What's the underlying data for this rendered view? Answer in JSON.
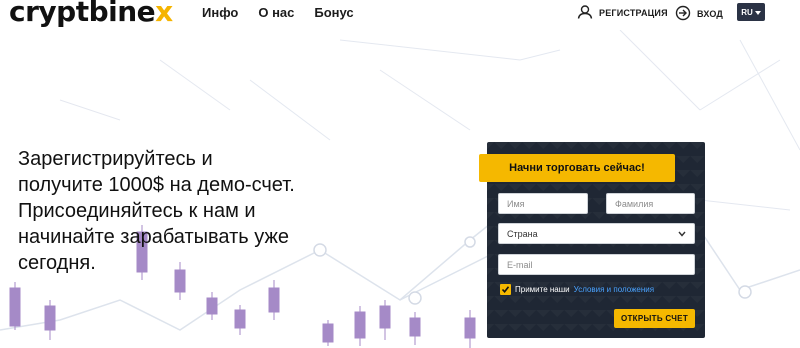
{
  "brand": {
    "logo_text": "cryptbine",
    "logo_accent": "x",
    "accent_color": "#f5b800",
    "dark_color": "#1f2734"
  },
  "header": {
    "nav": [
      {
        "label": "Инфо"
      },
      {
        "label": "О нас"
      },
      {
        "label": "Бонус"
      }
    ],
    "register": {
      "label": "РЕГИСТРАЦИЯ",
      "icon": "user-icon"
    },
    "login": {
      "label": "ВХОД",
      "icon": "sign-in-icon"
    },
    "language": {
      "label": "RU",
      "icon": "caret-down-icon"
    }
  },
  "hero": {
    "lines": [
      "Зарегистрируйтесь и",
      "получите 1000$ на демо-счет.",
      "Присоединяйтесь к нам и",
      "начинайте зарабатывать уже",
      "сегодня."
    ]
  },
  "form": {
    "title": "Начни торговать сейчас!",
    "first_name_placeholder": "Имя",
    "last_name_placeholder": "Фамилия",
    "country_label": "Страна",
    "email_placeholder": "E-mail",
    "consent_checked": true,
    "consent_text": "Примите наши",
    "terms_link": "Условия и положения",
    "submit_label": "ОТКРЫТЬ СЧЕТ"
  }
}
